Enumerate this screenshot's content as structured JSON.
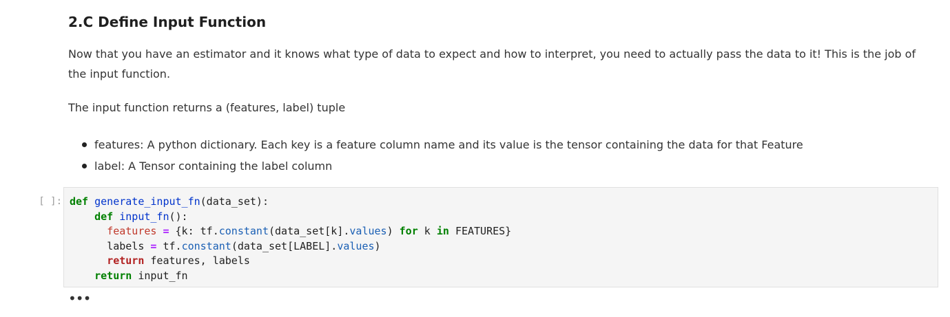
{
  "markdown": {
    "heading": "2.C Define Input Function",
    "paragraph1": "Now that you have an estimator and it knows what type of data to expect and how to interpret, you need to actually pass the data to it! This is the job of the input function.",
    "paragraph2": "The input function returns a (features, label) tuple",
    "bullets": [
      "features: A python dictionary. Each key is a feature column name and its value is the tensor containing the data for that Feature",
      "label: A Tensor containing the label column"
    ]
  },
  "code_cell": {
    "prompt": "[ ]:",
    "lines": {
      "l1_def": "def",
      "l1_rest": "generate_input_fn",
      "l1_tail": "(data_set):",
      "l2_def": "def",
      "l2_fn": "input_fn",
      "l2_tail": "():",
      "l3_var": "features",
      "l3_eq": "=",
      "l3_a": "{k: tf.",
      "l3_b": "constant",
      "l3_c": "(data_set[k].",
      "l3_d": "values",
      "l3_e": ")",
      "l3_for": "for",
      "l3_f": "k",
      "l3_in": "in",
      "l3_g": "FEATURES}",
      "l4_a": "labels",
      "l4_eq": "=",
      "l4_b": "tf.",
      "l4_c": "constant",
      "l4_d": "(data_set[LABEL].",
      "l4_e": "values",
      "l4_f": ")",
      "l5_ret": "return",
      "l5_rest": "features, labels",
      "l6_ret": "return",
      "l6_rest": "input_fn"
    }
  },
  "output_collapsed": "•••"
}
